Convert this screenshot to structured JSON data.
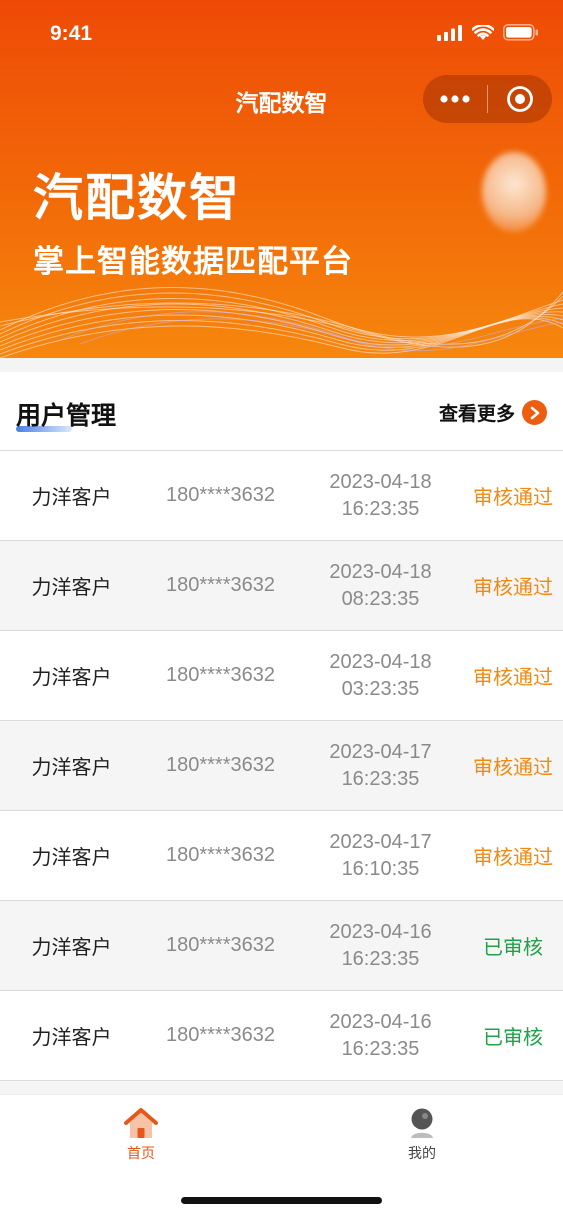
{
  "status_bar": {
    "time": "9:41"
  },
  "nav": {
    "title": "汽配数智"
  },
  "hero": {
    "title": "汽配数智",
    "subtitle": "掌上智能数据匹配平台"
  },
  "section": {
    "title": "用户管理",
    "more_label": "查看更多"
  },
  "users": [
    {
      "name": "力洋客户",
      "phone": "180****3632",
      "date": "2023-04-18",
      "time": "16:23:35",
      "status": "审核通过",
      "status_color": "#f08a12"
    },
    {
      "name": "力洋客户",
      "phone": "180****3632",
      "date": "2023-04-18",
      "time": "08:23:35",
      "status": "审核通过",
      "status_color": "#f08a12"
    },
    {
      "name": "力洋客户",
      "phone": "180****3632",
      "date": "2023-04-18",
      "time": "03:23:35",
      "status": "审核通过",
      "status_color": "#f08a12"
    },
    {
      "name": "力洋客户",
      "phone": "180****3632",
      "date": "2023-04-17",
      "time": "16:23:35",
      "status": "审核通过",
      "status_color": "#f08a12"
    },
    {
      "name": "力洋客户",
      "phone": "180****3632",
      "date": "2023-04-17",
      "time": "16:10:35",
      "status": "审核通过",
      "status_color": "#f08a12"
    },
    {
      "name": "力洋客户",
      "phone": "180****3632",
      "date": "2023-04-16",
      "time": "16:23:35",
      "status": "已审核",
      "status_color": "#1fa24a"
    },
    {
      "name": "力洋客户",
      "phone": "180****3632",
      "date": "2023-04-16",
      "time": "16:23:35",
      "status": "已审核",
      "status_color": "#1fa24a"
    }
  ],
  "tabbar": {
    "items": [
      {
        "label": "首页",
        "icon": "home-icon",
        "active": true
      },
      {
        "label": "我的",
        "icon": "profile-icon",
        "active": false
      }
    ]
  },
  "colors": {
    "brand": "#ee4a06",
    "accent": "#f6870d",
    "approved": "#f08a12",
    "reviewed": "#1fa24a"
  }
}
